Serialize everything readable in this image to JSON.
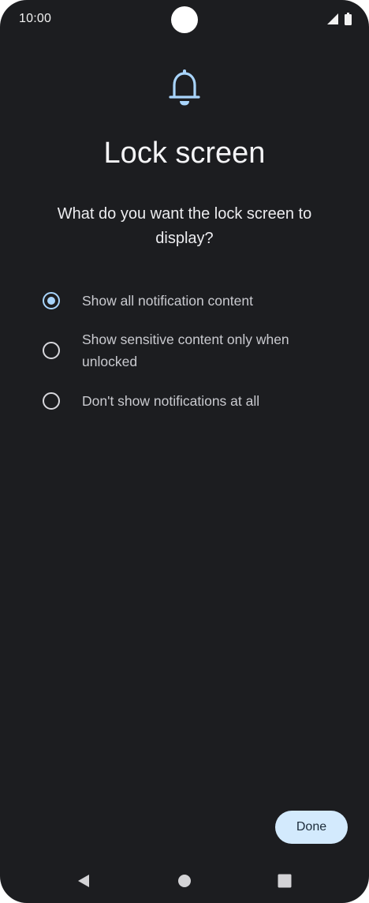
{
  "status_bar": {
    "time": "10:00",
    "icons": [
      "signal-icon",
      "battery-icon"
    ]
  },
  "header": {
    "icon": "bell-icon",
    "title": "Lock screen",
    "question": "What do you want the lock screen to display?"
  },
  "options": [
    {
      "label": "Show all notification content",
      "selected": true
    },
    {
      "label": "Show sensitive content only when unlocked",
      "selected": false
    },
    {
      "label": "Don't show notifications at all",
      "selected": false
    }
  ],
  "done_label": "Done",
  "nav": {
    "icons": [
      "back-icon",
      "home-icon",
      "recents-icon"
    ]
  },
  "colors": {
    "background": "#1c1d20",
    "accent": "#a8d4fb",
    "button_bg": "#d3eafd"
  }
}
